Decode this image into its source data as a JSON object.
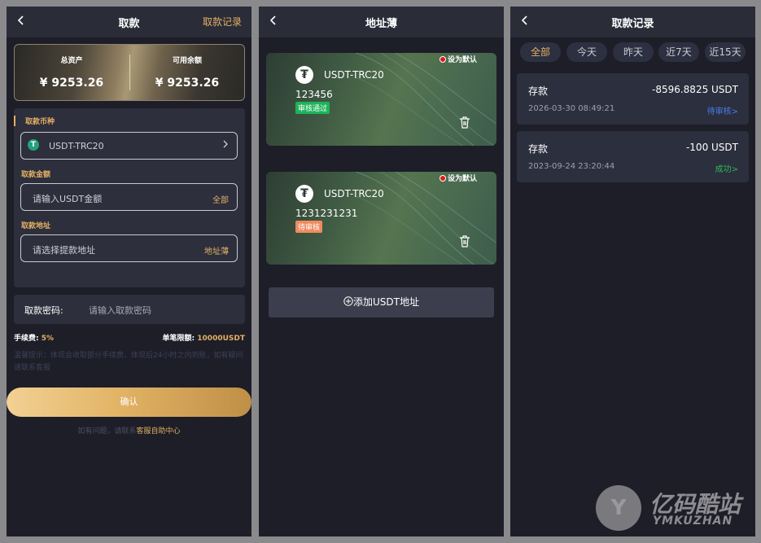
{
  "withdraw": {
    "title": "取款",
    "records_link": "取款记录",
    "assets": {
      "total_label": "总资产",
      "total_value": "¥ 9253.26",
      "available_label": "可用余额",
      "available_value": "¥ 9253.26"
    },
    "currency_label": "取款币种",
    "currency_value": "USDT-TRC20",
    "amount_label": "取款金额",
    "amount_placeholder": "请输入USDT金额",
    "amount_all": "全部",
    "address_label": "取款地址",
    "address_placeholder": "请选择提款地址",
    "address_book": "地址薄",
    "password_label": "取款密码:",
    "password_placeholder": "请输入取款密码",
    "fee_label": "手续费:",
    "fee_value": "5%",
    "limit_label": "单笔限额:",
    "limit_value": "10000USDT",
    "tip": "温馨提示：体现会收取部分手续费，体现后24小时之内到账，如有疑问请联系客服",
    "confirm": "确认",
    "help_prefix": "如有问题，请联系",
    "help_link": "客服自助中心"
  },
  "address_book": {
    "title": "地址薄",
    "cards": [
      {
        "network": "USDT-TRC20",
        "address": "123456",
        "status": "审核通过",
        "status_color": "#1fb35a",
        "default_label": "设为默认"
      },
      {
        "network": "USDT-TRC20",
        "address": "1231231231",
        "status": "待审核",
        "status_color": "#f08a5d",
        "default_label": "设为默认"
      }
    ],
    "add_button": "添加USDT地址"
  },
  "records": {
    "title": "取款记录",
    "filters": [
      "全部",
      "今天",
      "昨天",
      "近7天",
      "近15天"
    ],
    "active_filter": "全部",
    "items": [
      {
        "type": "存款",
        "amount": "-8596.8825 USDT",
        "date": "2026-03-30 08:49:21",
        "status": "待审核>",
        "status_color": "#4a7df0"
      },
      {
        "type": "存款",
        "amount": "-100 USDT",
        "date": "2023-09-24 23:20:44",
        "status": "成功>",
        "status_color": "#2fb856"
      }
    ]
  },
  "watermark": {
    "cn": "亿码酷站",
    "en": "YMKUZHAN"
  },
  "icons": {
    "back": "chevron-left-icon",
    "trash": "trash-icon",
    "add": "plus-circle-icon",
    "tether": "tether-icon"
  }
}
